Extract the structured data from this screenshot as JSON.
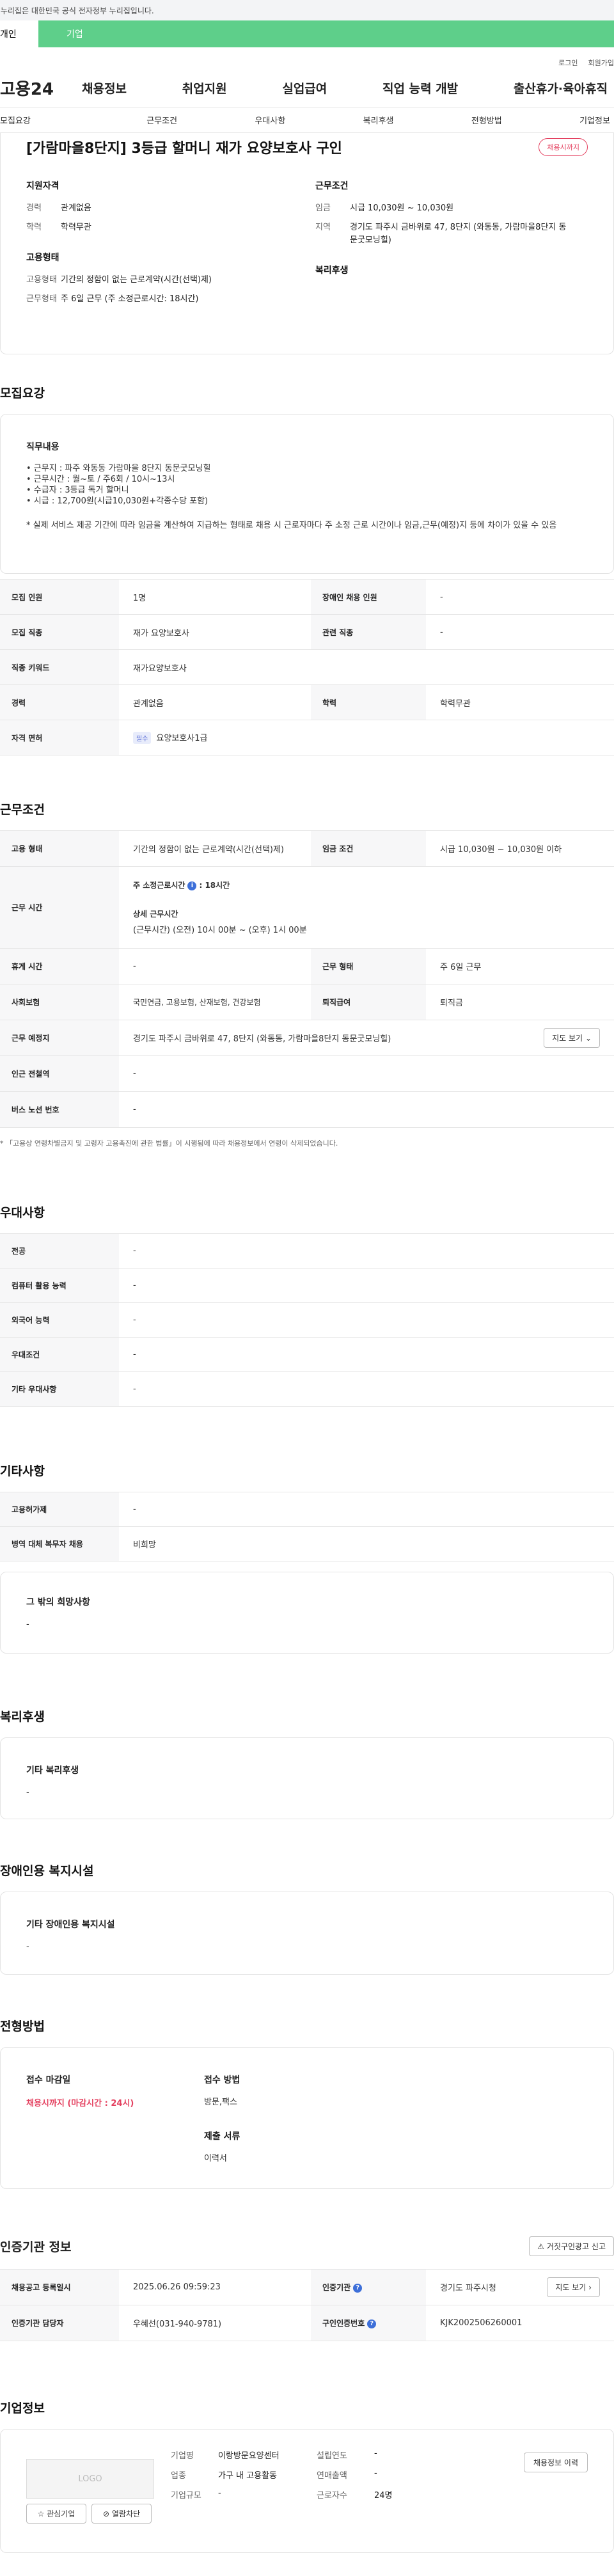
{
  "gov_notice": "이 누리집은 대한민국 공식 전자정부 누리집입니다.",
  "tabs": {
    "personal": "개인",
    "company": "기업"
  },
  "top_links": {
    "login": "로그인",
    "signup": "회원가입"
  },
  "logo": "고용24",
  "gnb": [
    "채용정보",
    "취업지원",
    "실업급여",
    "직업 능력 개발",
    "출산휴가·육아휴직"
  ],
  "subnav": [
    "모집요강",
    "근무조건",
    "우대사항",
    "복리후생",
    "전형방법",
    "기업정보"
  ],
  "hero": {
    "title": "[가람마을8단지] 3등급 할머니 재가 요양보호사 구인",
    "status_badge": "채용시까지",
    "qualification_title": "지원자격",
    "qualification": [
      {
        "k": "경력",
        "v": "관계없음"
      },
      {
        "k": "학력",
        "v": "학력무관"
      }
    ],
    "employment_title": "고용형태",
    "employment": [
      {
        "k": "고용형태",
        "v": "기간의 정함이 없는 근로계약(시간(선택)제)"
      },
      {
        "k": "근무형태",
        "v": "주 6일 근무 (주 소정근로시간: 18시간)"
      }
    ],
    "conditions_title": "근무조건",
    "conditions": [
      {
        "k": "임금",
        "v": "시급 10,030원 ~ 10,030원"
      },
      {
        "k": "지역",
        "v": "경기도 파주시 금바위로 47, 8단지 (와동동, 가람마을8단지 동문굿모닝힐)"
      }
    ],
    "welfare_title": "복리후생"
  },
  "recruit": {
    "section_title": "모집요강",
    "job_title": "직무내용",
    "job_lines": [
      "• 근무지 : 파주 와동동 가람마을 8단지 동문굿모닝힐",
      "• 근무시간 : 월~토 / 주6회 / 10시~13시",
      "• 수급자 : 3등급 독거 할머니",
      "• 시급 : 12,700원(시급10,030원+각종수당 포함)"
    ],
    "job_note": "* 실제 서비스 제공 기간에 따라 임금을 계산하여 지급하는 형태로 채용 시 근로자마다 주 소정 근로 시간이나 임금,근무(예정)지 등에 차이가 있을 수 있음",
    "rows": {
      "headcount_label": "모집 인원",
      "headcount": "1명",
      "disabled_label": "장애인 채용 인원",
      "disabled": "-",
      "job_label": "모집 직종",
      "job": "재가 요양보호사",
      "related_label": "관련 직종",
      "related": "-",
      "keyword_label": "직종 키워드",
      "keyword": "재가요양보호사",
      "career_label": "경력",
      "career": "관계없음",
      "edu_label": "학력",
      "edu": "학력무관",
      "license_label": "자격 면허",
      "license_tag": "필수",
      "license": "요양보호사1급"
    }
  },
  "work": {
    "section_title": "근무조건",
    "type_label": "고용 형태",
    "type": "기간의 정함이 없는 근로계약(시간(선택)제)",
    "wage_label": "임금 조건",
    "wage": "시급 10,030원 ~ 10,030원 이하",
    "hours_label": "근무 시간",
    "hours_weekly": "주 소정근로시간",
    "hours_weekly_value": ": 18시간",
    "hours_detail_title": "상세 근무시간",
    "hours_detail": "(근무시간) (오전) 10시 00분 ~ (오후) 1시 00분",
    "rest_label": "휴게 시간",
    "rest": "-",
    "shape_label": "근무 형태",
    "shape": "주 6일 근무",
    "insurance_label": "사회보험",
    "insurance": "국민연금, 고용보험, 산재보험, 건강보험",
    "retire_label": "퇴직급여",
    "retire": "퇴직금",
    "place_label": "근무 예정지",
    "place": "경기도 파주시 금바위로 47, 8단지 (와동동, 가람마을8단지 동문굿모닝힐)",
    "map_btn": "지도 보기",
    "subway_label": "인근 전철역",
    "subway": "-",
    "bus_label": "버스 노선 번호",
    "bus": "-",
    "footnote": "* 「고용상 연령차별금지 및 고령자 고용촉진에 관한 법률」이 시행됨에 따라 채용정보에서 연령이 삭제되었습니다."
  },
  "preference": {
    "section_title": "우대사항",
    "rows": [
      {
        "k": "전공",
        "v": "-"
      },
      {
        "k": "컴퓨터 활용 능력",
        "v": "-"
      },
      {
        "k": "외국어 능력",
        "v": "-"
      },
      {
        "k": "우대조건",
        "v": "-"
      },
      {
        "k": "기타 우대사항",
        "v": "-"
      }
    ]
  },
  "etc": {
    "section_title": "기타사항",
    "rows": [
      {
        "k": "고용허가제",
        "v": "-"
      },
      {
        "k": "병역 대체 복무자 채용",
        "v": "비희망"
      }
    ],
    "wish_title": "그 밖의 희망사항",
    "wish": "-"
  },
  "welfare": {
    "section_title": "복리후생",
    "box_title": "기타 복리후생",
    "value": "-"
  },
  "disabled_fac": {
    "section_title": "장애인용 복지시설",
    "box_title": "기타 장애인용 복지시설",
    "value": "-"
  },
  "process": {
    "section_title": "전형방법",
    "deadline_label": "접수 마감일",
    "deadline": "채용시까지 (마감시간 : 24시)",
    "method_label": "접수 방법",
    "method": "방문,팩스",
    "docs_label": "제출 서류",
    "docs": "이력서"
  },
  "cert": {
    "section_title": "인증기관 정보",
    "report_btn": "거짓구인광고 신고",
    "reg_label": "채용공고 등록일시",
    "reg": "2025.06.26 09:59:23",
    "org_label": "인증기관",
    "org": "경기도 파주시청",
    "map_btn": "지도 보기",
    "manager_label": "인증기관 담당자",
    "manager": "우혜선(031-940-9781)",
    "number_label": "구인인증번호",
    "number": "KJK2002506260001"
  },
  "company": {
    "section_title": "기업정보",
    "logo_text": "LOGO",
    "interest_btn": "관심기업",
    "block_btn": "열람차단",
    "history_btn": "채용정보 이력",
    "name_label": "기업명",
    "name": "이랑방문요양센터",
    "industry_label": "업종",
    "industry": "가구 내 고용활동",
    "size_label": "기업규모",
    "size": "-",
    "founded_label": "설립연도",
    "founded": "-",
    "sales_label": "연매출액",
    "sales": "-",
    "employees_label": "근로자수",
    "employees": "24명"
  }
}
